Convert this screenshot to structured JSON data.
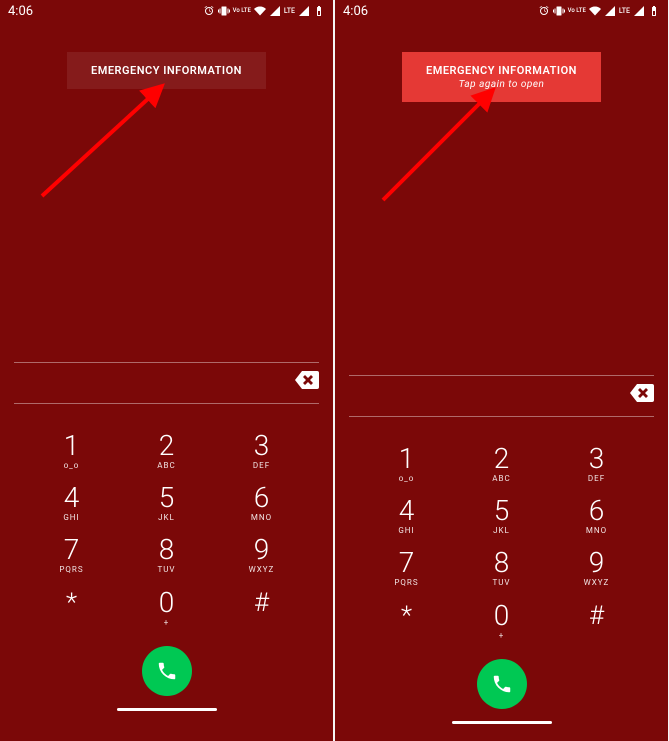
{
  "status": {
    "time": "4:06",
    "volte_text": "Vo LTE",
    "lte_text": "LTE"
  },
  "emergency": {
    "label": "EMERGENCY INFORMATION",
    "subtext": "Tap again to open"
  },
  "dialpad": {
    "keys": [
      {
        "d": "1",
        "l": "ᴏ_ᴏ"
      },
      {
        "d": "2",
        "l": "ABC"
      },
      {
        "d": "3",
        "l": "DEF"
      },
      {
        "d": "4",
        "l": "GHI"
      },
      {
        "d": "5",
        "l": "JKL"
      },
      {
        "d": "6",
        "l": "MNO"
      },
      {
        "d": "7",
        "l": "PQRS"
      },
      {
        "d": "8",
        "l": "TUV"
      },
      {
        "d": "9",
        "l": "WXYZ"
      },
      {
        "d": "*",
        "l": ""
      },
      {
        "d": "0",
        "l": "+"
      },
      {
        "d": "#",
        "l": ""
      }
    ]
  },
  "colors": {
    "background": "#7b0808",
    "emergency_active": "#e53935",
    "call_button": "#00c853",
    "arrow": "#ff0000"
  }
}
